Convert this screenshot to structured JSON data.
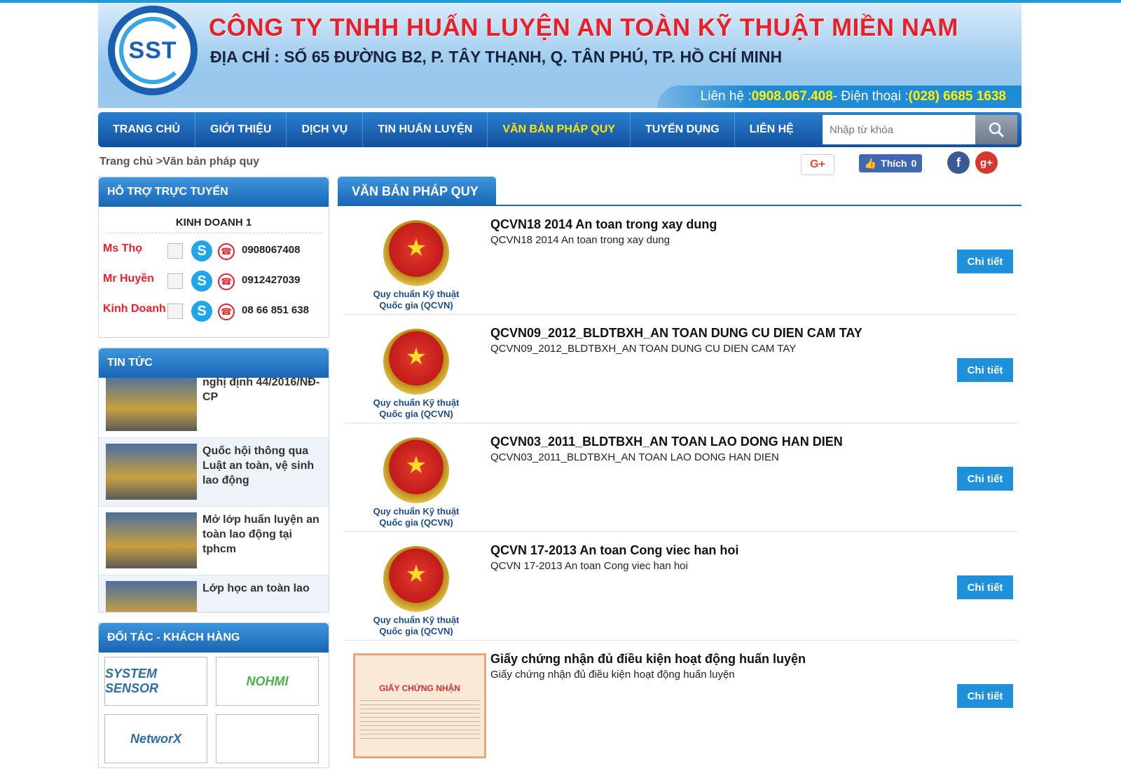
{
  "header": {
    "logo_text": "SST",
    "company": "CÔNG TY TNHH HUẤN LUYỆN AN TOÀN KỸ THUẬT MIỀN NAM",
    "address": "ĐỊA CHỈ : SỐ 65 ĐƯỜNG B2, P. TÂY THẠNH, Q. TÂN PHÚ, TP. HỒ CHÍ MINH",
    "contact_label": "Liên hệ : ",
    "contact_mobile": "0908.067.408",
    "phone_label": " - Điện thoại : ",
    "phone": "(028) 6685 1638"
  },
  "nav": {
    "items": [
      "TRANG CHỦ",
      "GIỚI THIỆU",
      "DỊCH VỤ",
      "TIN HUẤN LUYỆN",
      "VĂN BẢN PHÁP QUY",
      "TUYỂN DỤNG",
      "LIÊN HỆ"
    ],
    "active_index": 4,
    "search_placeholder": "Nhập từ khóa"
  },
  "breadcrumb": {
    "home": "Trang chủ",
    "sep": " >",
    "current": "Văn bản pháp quy"
  },
  "social": {
    "gplus": "G+",
    "like_label": "Thích",
    "like_count": "0",
    "fb": "f",
    "gp": "g+"
  },
  "sidebar": {
    "support_title": "HỖ TRỢ TRỰC TUYẾN",
    "support_group": "KINH DOANH 1",
    "contacts": [
      {
        "name": "Ms Thọ",
        "phone": "0908067408"
      },
      {
        "name": "Mr Huyền",
        "phone": "0912427039"
      },
      {
        "name": "Kinh Doanh",
        "phone": "08 66 851 638"
      }
    ],
    "news_title": "TIN TỨC",
    "news": [
      "nghị định 44/2016/NĐ-CP",
      "Quốc hội thông qua Luật an toàn, vệ sinh lao động",
      "Mở lớp huấn luyện an toàn lao động tại tphcm",
      "Lớp học an toàn lao"
    ],
    "partners_title": "ĐỐI TÁC - KHÁCH HÀNG",
    "partners": [
      "SYSTEM SENSOR",
      "NOHMI",
      "NetworX",
      ""
    ]
  },
  "main": {
    "tab": "VĂN BẢN PHÁP QUY",
    "emblem_caption_1": "Quy chuẩn Kỹ thuật",
    "emblem_caption_2": "Quốc gia (QCVN)",
    "cert_title": "GIẤY CHỨNG NHẬN",
    "detail_label": "Chi tiết",
    "docs": [
      {
        "title": "QCVN18 2014 An toan trong xay dung",
        "sub": "QCVN18 2014 An toan trong xay dung"
      },
      {
        "title": "QCVN09_2012_BLDTBXH_AN TOAN DUNG CU DIEN CAM TAY",
        "sub": "QCVN09_2012_BLDTBXH_AN TOAN DUNG CU DIEN CAM TAY"
      },
      {
        "title": "QCVN03_2011_BLDTBXH_AN TOAN LAO DONG HAN DIEN",
        "sub": "QCVN03_2011_BLDTBXH_AN TOAN LAO DONG HAN DIEN"
      },
      {
        "title": "QCVN 17-2013 An toan Cong viec han hoi",
        "sub": "QCVN 17-2013 An toan Cong viec han hoi"
      },
      {
        "title": "Giấy chứng nhận đủ điều kiện hoạt động huấn luyện",
        "sub": "Giấy chứng nhận đủ điều kiện hoạt động huấn luyện"
      }
    ]
  }
}
